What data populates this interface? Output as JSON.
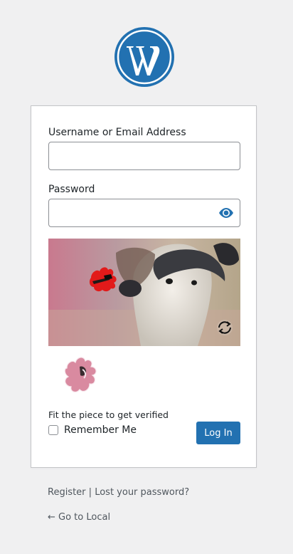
{
  "logo": {
    "icon": "wordpress-logo-icon",
    "color": "#2271b1"
  },
  "form": {
    "username_label": "Username or Email Address",
    "username_value": "",
    "password_label": "Password",
    "password_value": "",
    "show_password_icon": "eye-icon",
    "captcha": {
      "hint": "Fit the piece to get verified",
      "refresh_icon": "refresh-icon",
      "piece_color": "#d98aa0",
      "target_color": "#e21a1a"
    },
    "remember_label": "Remember Me",
    "remember_checked": false,
    "login_label": "Log In",
    "accent": "#2271b1"
  },
  "footer": {
    "register": "Register",
    "separator": "|",
    "lost_password": "Lost your password?",
    "back_link": "← Go to Local"
  }
}
